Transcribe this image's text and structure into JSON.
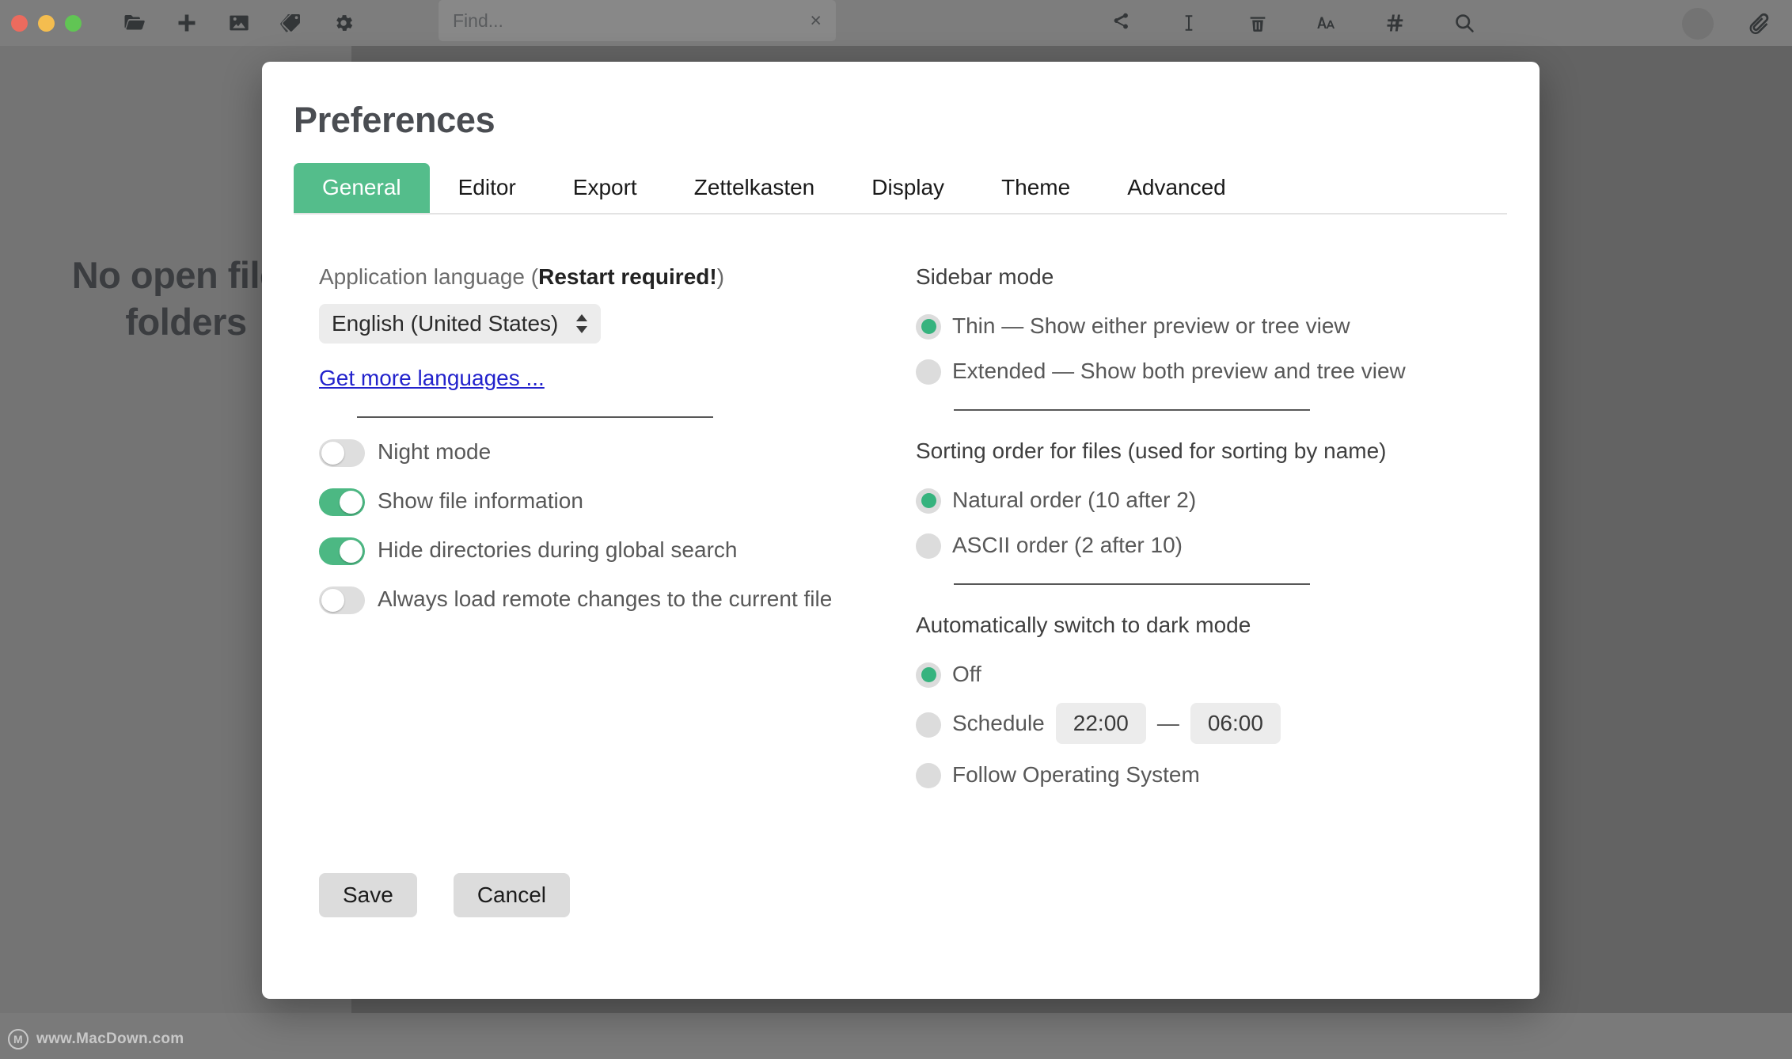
{
  "titlebar": {
    "window_controls": [
      "close",
      "minimize",
      "maximize"
    ],
    "left_icons": [
      {
        "name": "folder-open-icon",
        "label": "Open folder"
      },
      {
        "name": "plus-icon",
        "label": "New file"
      },
      {
        "name": "image-icon",
        "label": "Insert image"
      },
      {
        "name": "tag-icon",
        "label": "Tags"
      },
      {
        "name": "gear-icon",
        "label": "Preferences"
      }
    ],
    "find": {
      "placeholder": "Find...",
      "value": "",
      "clear_label": "×"
    },
    "right_icons": [
      {
        "name": "share-icon",
        "label": "Share"
      },
      {
        "name": "text-cursor-icon",
        "label": "Insert text"
      },
      {
        "name": "trash-icon",
        "label": "Delete"
      },
      {
        "name": "font-size-icon",
        "label": "Font size"
      },
      {
        "name": "hashtag-icon",
        "label": "Tags / headings"
      },
      {
        "name": "search-icon",
        "label": "Search"
      }
    ],
    "avatar_label": "",
    "attachment_icon": "paperclip-icon"
  },
  "background": {
    "empty_message_line1": "No open files",
    "empty_message_line2": "folders",
    "watermark_logo": "M",
    "watermark_text": "www.MacDown.com"
  },
  "dialog": {
    "title": "Preferences",
    "tabs": [
      {
        "label": "General",
        "active": true
      },
      {
        "label": "Editor",
        "active": false
      },
      {
        "label": "Export",
        "active": false
      },
      {
        "label": "Zettelkasten",
        "active": false
      },
      {
        "label": "Display",
        "active": false
      },
      {
        "label": "Theme",
        "active": false
      },
      {
        "label": "Advanced",
        "active": false
      }
    ],
    "left_column": {
      "language_label_prefix": "Application language (",
      "language_label_strong": "Restart required!",
      "language_label_suffix": ")",
      "language_value": "English (United States)",
      "language_options": [
        "English (United States)"
      ],
      "more_languages_link": "Get more languages ...",
      "toggles": [
        {
          "label": "Night mode",
          "on": false
        },
        {
          "label": "Show file information",
          "on": true
        },
        {
          "label": "Hide directories during global search",
          "on": true
        },
        {
          "label": "Always load remote changes to the current file",
          "on": false
        }
      ]
    },
    "right_column": {
      "sidebar_mode": {
        "heading": "Sidebar mode",
        "options": [
          {
            "label": "Thin — Show either preview or tree view",
            "selected": true
          },
          {
            "label": "Extended — Show both preview and tree view",
            "selected": false
          }
        ]
      },
      "sorting_order": {
        "heading": "Sorting order for files (used for sorting by name)",
        "options": [
          {
            "label": "Natural order (10 after 2)",
            "selected": true
          },
          {
            "label": "ASCII order (2 after 10)",
            "selected": false
          }
        ]
      },
      "dark_mode": {
        "heading": "Automatically switch to dark mode",
        "options": [
          {
            "label": "Off",
            "selected": true
          },
          {
            "label": "Schedule",
            "selected": false
          },
          {
            "label": "Follow Operating System",
            "selected": false
          }
        ],
        "schedule_start": "22:00",
        "schedule_separator": "—",
        "schedule_end": "06:00"
      }
    },
    "buttons": {
      "save": "Save",
      "cancel": "Cancel"
    }
  },
  "colors": {
    "accent_green": "#54bd8b",
    "toggle_on": "#4cb883",
    "radio_on": "#36b37e",
    "link": "#2222cc",
    "dialog_bg": "#ffffff",
    "app_bg": "#7a7a7a"
  }
}
